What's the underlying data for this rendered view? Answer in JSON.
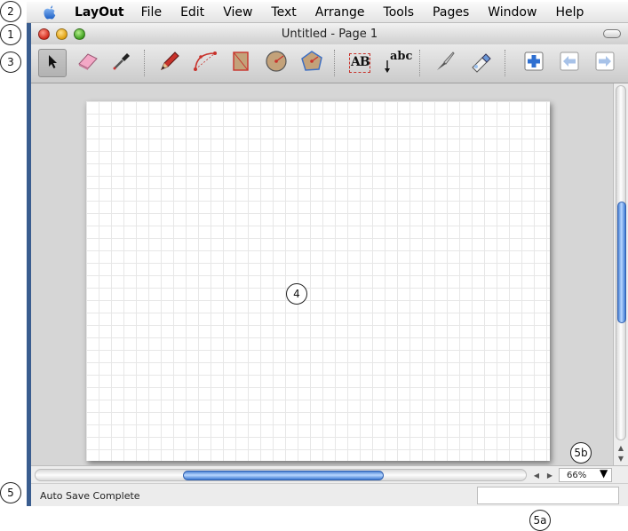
{
  "callouts": {
    "titlebar": "1",
    "menubar": "2",
    "toolbar": "3",
    "drawing_area": "4",
    "status_bar": "5",
    "measurements_box": "5a",
    "zoom_control": "5b"
  },
  "menubar": {
    "apple_icon": "apple-icon",
    "app_name": "LayOut",
    "items": [
      "File",
      "Edit",
      "View",
      "Text",
      "Arrange",
      "Tools",
      "Pages",
      "Window",
      "Help"
    ]
  },
  "window": {
    "title": "Untitled - Page 1"
  },
  "toolbar": {
    "tools": [
      {
        "name": "select-tool",
        "icon": "arrow-icon",
        "selected": true
      },
      {
        "name": "eraser-tool",
        "icon": "eraser-icon"
      },
      {
        "name": "style-tool",
        "icon": "eyedropper-icon"
      },
      {
        "name": "line-tool",
        "icon": "pencil-icon"
      },
      {
        "name": "arc-tool",
        "icon": "arc-icon"
      },
      {
        "name": "rectangle-tool",
        "icon": "rectangle-icon"
      },
      {
        "name": "circle-tool",
        "icon": "circle-icon"
      },
      {
        "name": "polygon-tool",
        "icon": "polygon-icon"
      },
      {
        "name": "text-tool",
        "icon": "text-ab-icon",
        "label": "AB"
      },
      {
        "name": "label-tool",
        "icon": "label-abc-icon",
        "label": "abc"
      },
      {
        "name": "split-tool",
        "icon": "knife-icon"
      },
      {
        "name": "join-tool",
        "icon": "glue-icon"
      },
      {
        "name": "add-page-button",
        "icon": "plus-page-icon"
      },
      {
        "name": "previous-page-button",
        "icon": "left-arrow-page-icon"
      },
      {
        "name": "next-page-button",
        "icon": "right-arrow-page-icon"
      }
    ]
  },
  "statusbar": {
    "message": "Auto Save Complete",
    "measurements_value": ""
  },
  "zoom": {
    "value": "66%"
  }
}
